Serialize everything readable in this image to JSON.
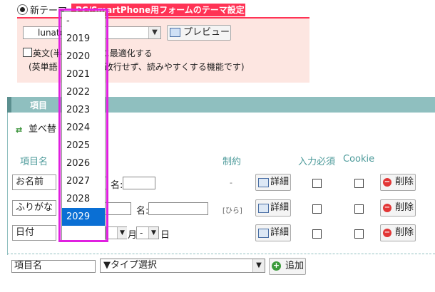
{
  "theme": {
    "radio_label": "新テーマ",
    "sp_banner": "PC/SmartPhone用フォームのテーマ設定",
    "select_value": "lunatc",
    "preview_label": "プレビュー",
    "english_line1": "英文(半",
    "english_line1b": "に最適化する",
    "english_line2": "(英単語",
    "english_line2b": "動改行せず、読みやすくする機能です)"
  },
  "items": {
    "section_title": "項目",
    "sort_label": "並べ替",
    "sort_icon": "sort-icon",
    "headers": {
      "name": "項目名",
      "constraint": "制約",
      "required": "入力必須",
      "cookie": "Cookie"
    },
    "rows": [
      {
        "label": "お名前",
        "mid_label": "名:",
        "constraint": "-",
        "detail": "詳細",
        "delete": "削除"
      },
      {
        "label": "ふりがな",
        "mid_label": "名:",
        "constraint": "[ひら]",
        "detail": "詳細",
        "delete": "削除"
      },
      {
        "label": "日付",
        "year_value": "-",
        "year_unit": "年",
        "month_unit": "月",
        "day_value": "-",
        "day_unit": "日",
        "detail": "詳細",
        "delete": "削除"
      }
    ],
    "new_item_name": "項目名",
    "type_select": "▼タイプ選択",
    "add_label": "追加"
  },
  "year_dropdown": {
    "options": [
      "-",
      "2019",
      "2020",
      "2021",
      "2022",
      "2023",
      "2024",
      "2025",
      "2026",
      "2027",
      "2028",
      "2029"
    ],
    "selected": "2029",
    "highlight_color": "#e020e0"
  }
}
